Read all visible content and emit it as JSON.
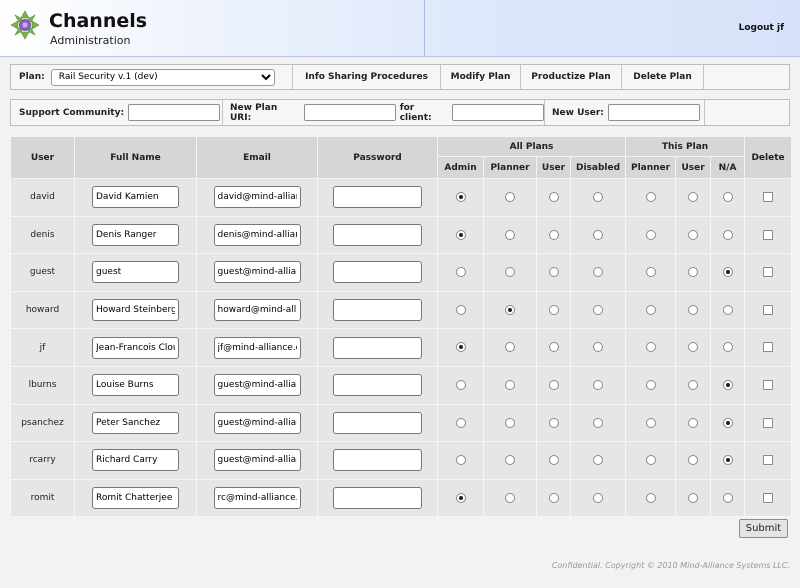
{
  "app": {
    "title": "Channels",
    "subtitle": "Administration",
    "logout": "Logout jf"
  },
  "toolbar": {
    "plan_label": "Plan:",
    "plan_selected": "Rail Security v.1 (dev)",
    "actions": [
      "Info Sharing Procedures",
      "Modify Plan",
      "Productize Plan",
      "Delete Plan"
    ]
  },
  "toolbar2": {
    "support_community_label": "Support Community:",
    "new_plan_uri_label": "New Plan URI:",
    "for_client_label": "for client:",
    "new_user_label": "New User:"
  },
  "table": {
    "headers": {
      "user": "User",
      "full_name": "Full Name",
      "email": "Email",
      "password": "Password",
      "all_plans": "All Plans",
      "this_plan": "This Plan",
      "delete": "Delete",
      "admin": "Admin",
      "planner": "Planner",
      "user_sub": "User",
      "disabled": "Disabled",
      "tp_planner": "Planner",
      "tp_user": "User",
      "tp_na": "N/A"
    },
    "rows": [
      {
        "user": "david",
        "full_name": "David Kamien",
        "email": "david@mind-allian",
        "all_plans": "Admin",
        "this_plan": ""
      },
      {
        "user": "denis",
        "full_name": "Denis Ranger",
        "email": "denis@mind-allian",
        "all_plans": "Admin",
        "this_plan": ""
      },
      {
        "user": "guest",
        "full_name": "guest",
        "email": "guest@mind-allian",
        "all_plans": "",
        "this_plan": "N/A"
      },
      {
        "user": "howard",
        "full_name": "Howard Steinberg",
        "email": "howard@mind-alli",
        "all_plans": "Planner",
        "this_plan": ""
      },
      {
        "user": "jf",
        "full_name": "Jean-Francois Clou",
        "email": "jf@mind-alliance.c",
        "all_plans": "Admin",
        "this_plan": ""
      },
      {
        "user": "lburns",
        "full_name": "Louise Burns",
        "email": "guest@mind-allian",
        "all_plans": "",
        "this_plan": "N/A"
      },
      {
        "user": "psanchez",
        "full_name": "Peter Sanchez",
        "email": "guest@mind-allian",
        "all_plans": "",
        "this_plan": "N/A"
      },
      {
        "user": "rcarry",
        "full_name": "Richard Carry",
        "email": "guest@mind-allian",
        "all_plans": "",
        "this_plan": "N/A"
      },
      {
        "user": "romit",
        "full_name": "Romit Chatterjee",
        "email": "rc@mind-alliance.",
        "all_plans": "Admin",
        "this_plan": ""
      }
    ]
  },
  "submit_label": "Submit",
  "footer": "Confidential. Copyright © 2010 Mind-Alliance Systems LLC."
}
